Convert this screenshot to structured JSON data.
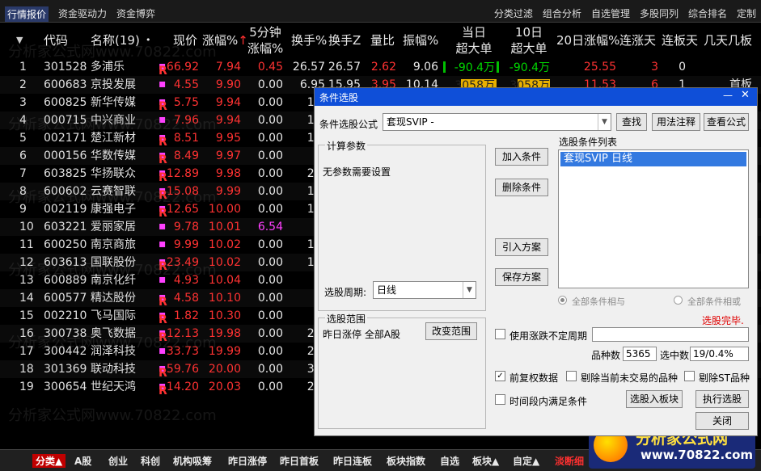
{
  "topbar": {
    "left_tabs": [
      "行情报价",
      "资金驱动力",
      "资金博弈"
    ],
    "right_tabs": [
      "分类过滤",
      "组合分析",
      "自选管理",
      "多股同列",
      "综合排名",
      "定制"
    ]
  },
  "header": {
    "code": "代码",
    "name": "名称(19)",
    "price": "现价",
    "change_pct": "涨幅%",
    "change5_l1": "5分钟",
    "change5_l2": "涨幅%",
    "turnover": "换手%",
    "turnover_z": "换手Z",
    "volume_ratio": "量比",
    "amplitude": "振幅%",
    "day_l1": "当日",
    "day_l2": "超大单",
    "d10_l1": "10日",
    "d10_l2": "超大单",
    "d20": "20日涨幅%",
    "rise_days": "连涨天",
    "limit_days": "连板天",
    "few_days": "几天几板"
  },
  "rows": [
    {
      "n": "1",
      "code": "301528",
      "name": "多浦乐",
      "r": "R",
      "price": "66.92",
      "pct": "7.94",
      "p5": "0.45",
      "to": "26.57",
      "toz": "26.57",
      "vr": "2.62",
      "amp": "9.06",
      "day": "-90.4万",
      "d10": "-90.4万",
      "d20": "25.55",
      "rise": "3",
      "limit": "0",
      "few": ""
    },
    {
      "n": "2",
      "code": "600683",
      "name": "京投发展",
      "r": "",
      "price": "4.55",
      "pct": "9.90",
      "p5": "0.00",
      "to": "6.95",
      "toz": "15.95",
      "vr": "3.95",
      "amp": "10.14",
      "day": "3058万",
      "d10": "3058万",
      "d20": "11.53",
      "rise": "6",
      "limit": "1",
      "few": "首板"
    },
    {
      "n": "3",
      "code": "600825",
      "name": "新华传媒",
      "r": "R",
      "price": "5.75",
      "pct": "9.94",
      "p5": "0.00",
      "to": "11.",
      "toz": "",
      "vr": "",
      "amp": "",
      "day": "",
      "d10": "",
      "d20": "",
      "rise": "",
      "limit": "",
      "few": ""
    },
    {
      "n": "4",
      "code": "000715",
      "name": "中兴商业",
      "r": "",
      "price": "7.96",
      "pct": "9.94",
      "p5": "0.00",
      "to": "10.",
      "toz": "",
      "vr": "",
      "amp": "",
      "day": "",
      "d10": "",
      "d20": "",
      "rise": "",
      "limit": "",
      "few": ""
    },
    {
      "n": "5",
      "code": "002171",
      "name": "楚江新材",
      "r": "R",
      "price": "8.51",
      "pct": "9.95",
      "p5": "0.00",
      "to": "10.",
      "toz": "",
      "vr": "",
      "amp": "",
      "day": "",
      "d10": "",
      "d20": "",
      "rise": "",
      "limit": "",
      "few": ""
    },
    {
      "n": "6",
      "code": "000156",
      "name": "华数传媒",
      "r": "R",
      "price": "8.49",
      "pct": "9.97",
      "p5": "0.00",
      "to": "3.",
      "toz": "",
      "vr": "",
      "amp": "",
      "day": "",
      "d10": "",
      "d20": "",
      "rise": "",
      "limit": "",
      "few": ""
    },
    {
      "n": "7",
      "code": "603825",
      "name": "华扬联众",
      "r": "R",
      "price": "12.89",
      "pct": "9.98",
      "p5": "0.00",
      "to": "24.",
      "toz": "",
      "vr": "",
      "amp": "",
      "day": "",
      "d10": "",
      "d20": "",
      "rise": "",
      "limit": "",
      "few": ""
    },
    {
      "n": "8",
      "code": "600602",
      "name": "云赛智联",
      "r": "R",
      "price": "15.08",
      "pct": "9.99",
      "p5": "0.00",
      "to": "10.",
      "toz": "",
      "vr": "",
      "amp": "",
      "day": "",
      "d10": "",
      "d20": "",
      "rise": "",
      "limit": "",
      "few": ""
    },
    {
      "n": "9",
      "code": "002119",
      "name": "康强电子",
      "r": "R",
      "price": "12.65",
      "pct": "10.00",
      "p5": "0.00",
      "to": "10.",
      "toz": "",
      "vr": "",
      "amp": "",
      "day": "",
      "d10": "",
      "d20": "",
      "rise": "",
      "limit": "",
      "few": ""
    },
    {
      "n": "10",
      "code": "603221",
      "name": "爱丽家居",
      "r": "",
      "price": "9.78",
      "pct": "10.01",
      "p5": "6.54",
      "to": "2.",
      "toz": "",
      "vr": "",
      "amp": "",
      "day": "",
      "d10": "",
      "d20": "",
      "rise": "",
      "limit": "",
      "few": ""
    },
    {
      "n": "11",
      "code": "600250",
      "name": "南京商旅",
      "r": "",
      "price": "9.99",
      "pct": "10.02",
      "p5": "0.00",
      "to": "10.",
      "toz": "",
      "vr": "",
      "amp": "",
      "day": "",
      "d10": "",
      "d20": "",
      "rise": "",
      "limit": "",
      "few": ""
    },
    {
      "n": "12",
      "code": "603613",
      "name": "国联股份",
      "r": "R",
      "price": "23.49",
      "pct": "10.02",
      "p5": "0.00",
      "to": "10.",
      "toz": "",
      "vr": "",
      "amp": "",
      "day": "",
      "d10": "",
      "d20": "",
      "rise": "",
      "limit": "",
      "few": ""
    },
    {
      "n": "13",
      "code": "600889",
      "name": "南京化纤",
      "r": "",
      "price": "4.93",
      "pct": "10.04",
      "p5": "0.00",
      "to": "3.",
      "toz": "",
      "vr": "",
      "amp": "",
      "day": "",
      "d10": "",
      "d20": "",
      "rise": "",
      "limit": "",
      "few": ""
    },
    {
      "n": "14",
      "code": "600577",
      "name": "精达股份",
      "r": "R",
      "price": "4.58",
      "pct": "10.10",
      "p5": "0.00",
      "to": "3.",
      "toz": "",
      "vr": "",
      "amp": "",
      "day": "",
      "d10": "",
      "d20": "",
      "rise": "",
      "limit": "",
      "few": ""
    },
    {
      "n": "15",
      "code": "002210",
      "name": "飞马国际",
      "r": "R",
      "price": "1.82",
      "pct": "10.30",
      "p5": "0.00",
      "to": "3.",
      "toz": "",
      "vr": "",
      "amp": "",
      "day": "",
      "d10": "",
      "d20": "",
      "rise": "",
      "limit": "",
      "few": ""
    },
    {
      "n": "16",
      "code": "300738",
      "name": "奥飞数据",
      "r": "R",
      "price": "12.13",
      "pct": "19.98",
      "p5": "0.00",
      "to": "25.",
      "toz": "",
      "vr": "",
      "amp": "",
      "day": "",
      "d10": "",
      "d20": "",
      "rise": "",
      "limit": "",
      "few": ""
    },
    {
      "n": "17",
      "code": "300442",
      "name": "润泽科技",
      "r": "",
      "price": "33.73",
      "pct": "19.99",
      "p5": "0.00",
      "to": "25.",
      "toz": "",
      "vr": "",
      "amp": "",
      "day": "",
      "d10": "",
      "d20": "",
      "rise": "",
      "limit": "",
      "few": ""
    },
    {
      "n": "18",
      "code": "301369",
      "name": "联动科技",
      "r": "R",
      "price": "59.76",
      "pct": "20.00",
      "p5": "0.00",
      "to": "39.",
      "toz": "",
      "vr": "",
      "amp": "",
      "day": "",
      "d10": "",
      "d20": "",
      "rise": "",
      "limit": "",
      "few": ""
    },
    {
      "n": "19",
      "code": "300654",
      "name": "世纪天鸿",
      "r": "R",
      "price": "14.20",
      "pct": "20.03",
      "p5": "0.00",
      "to": "25.",
      "toz": "",
      "vr": "",
      "amp": "",
      "day": "",
      "d10": "",
      "d20": "",
      "rise": "",
      "limit": "",
      "few": ""
    }
  ],
  "bottombar": [
    "分类▲",
    "A股",
    "创业",
    "科创",
    "机构吸筹",
    "昨日涨停",
    "昨日首板",
    "昨日连板",
    "板块指数",
    "自选",
    "板块▲",
    "自定▲",
    "淡断细"
  ],
  "badge": {
    "title": "分析家公式网",
    "url": "www.70822.com"
  },
  "watermark": "分析家公式网www.70822.com",
  "dialog": {
    "title": "条件选股",
    "formula_label": "条件选股公式",
    "formula_value": "套现SVIP    -",
    "btn_find": "查找",
    "btn_usage": "用法注释",
    "btn_view": "查看公式",
    "calc_group": "计算参数",
    "no_params": "无参数需要设置",
    "btn_add": "加入条件",
    "btn_delete": "删除条件",
    "btn_import": "引入方案",
    "btn_save": "保存方案",
    "cond_list_label": "选股条件列表",
    "cond_list_item": "套现SVIP  日线",
    "period_label": "选股周期:",
    "period_value": "日线",
    "radio_and": "全部条件相与",
    "radio_or": "全部条件相或",
    "range_group": "选股范围",
    "range_text": "昨日涨停 全部A股",
    "btn_change_range": "改变范围",
    "status_done": "选股完毕.",
    "chk_uncertain": "使用涨跌不定周期",
    "count_label": "品种数",
    "count_value": "5365",
    "selected_label": "选中数",
    "selected_value": "19/0.4%",
    "chk_restore": "前复权数据",
    "chk_exclude_untraded": "剔除当前未交易的品种",
    "chk_exclude_st": "剔除ST品种",
    "chk_period_all": "时间段内满足条件",
    "btn_to_block": "选股入板块",
    "btn_execute": "执行选股",
    "btn_close": "关闭"
  }
}
